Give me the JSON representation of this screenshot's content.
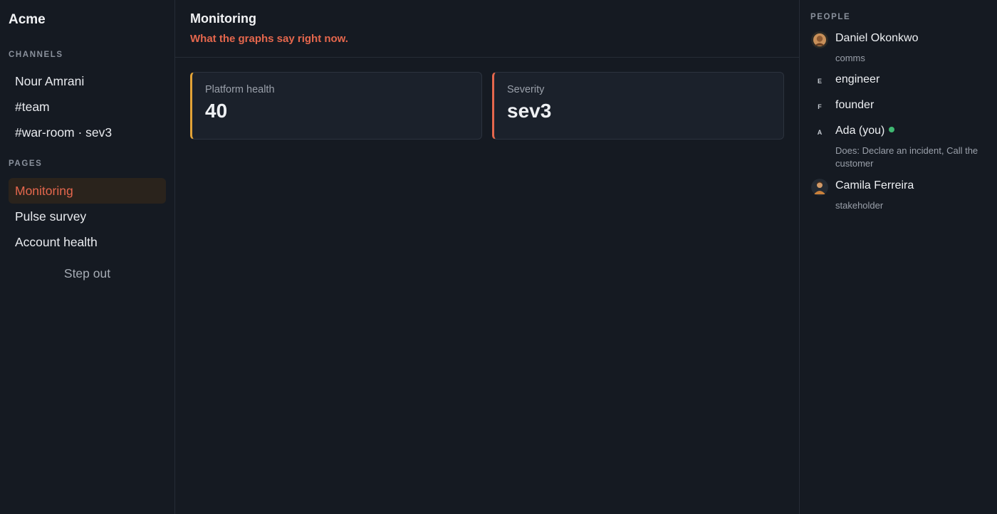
{
  "brand": "Acme",
  "sidebar": {
    "channels_label": "CHANNELS",
    "channels": [
      {
        "label": "Nour Amrani"
      },
      {
        "label": "#team"
      },
      {
        "label": "#war-room · sev3"
      }
    ],
    "pages_label": "PAGES",
    "pages": [
      {
        "label": "Monitoring",
        "active": true
      },
      {
        "label": "Pulse survey"
      },
      {
        "label": "Account health"
      }
    ],
    "step_out": "Step out"
  },
  "main": {
    "title": "Monitoring",
    "subtitle": "What the graphs say right now.",
    "cards": [
      {
        "label": "Platform health",
        "value": "40",
        "accent": "#e2a337"
      },
      {
        "label": "Severity",
        "value": "sev3",
        "accent": "#e5674d"
      }
    ]
  },
  "people": {
    "label": "PEOPLE",
    "items": [
      {
        "name": "Daniel Okonkwo",
        "sub": "comms",
        "avatar": "photo"
      },
      {
        "name": "engineer",
        "avatar_letter": "E"
      },
      {
        "name": "founder",
        "avatar_letter": "F"
      },
      {
        "name": "Ada (you)",
        "avatar_letter": "A",
        "online": true,
        "sub": "Does: Declare an incident, Call the customer"
      },
      {
        "name": "Camila Ferreira",
        "sub": "stakeholder",
        "avatar": "photo"
      }
    ]
  },
  "colors": {
    "accent": "#e5674d",
    "online": "#3fb872",
    "background": "#151a22"
  }
}
